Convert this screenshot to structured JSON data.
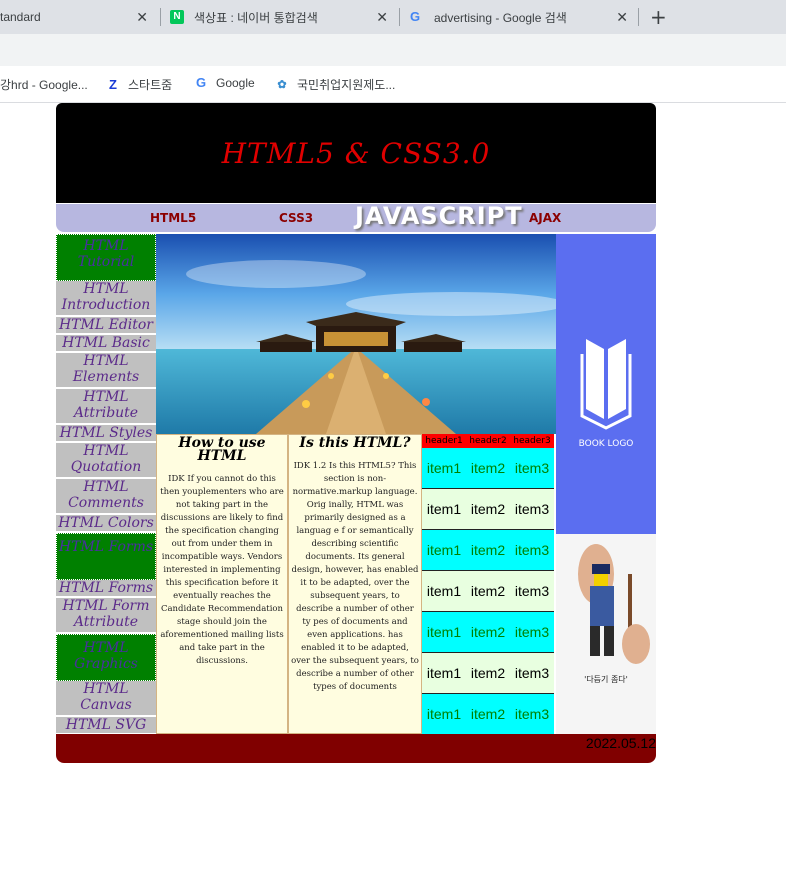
{
  "browser": {
    "tabs": [
      {
        "label": "tandard"
      },
      {
        "label": "색상표 : 네이버 통합검색",
        "favicon": "naver-icon"
      },
      {
        "label": "advertising - Google 검색",
        "favicon": "google-icon"
      }
    ],
    "bookmarks": [
      {
        "label": "강hrd - Google..."
      },
      {
        "label": "스타트줌",
        "icon": "zoom-icon"
      },
      {
        "label": "Google",
        "icon": "google-icon"
      },
      {
        "label": "국민취업지원제도...",
        "icon": "gov-icon"
      }
    ]
  },
  "page": {
    "title": "HTML5 & CSS3.0",
    "nav": [
      "HTML5",
      "CSS3",
      "JAVASCRIPT",
      "AJAX"
    ],
    "sidebar": [
      "HTML Tutorial",
      "HTML Introduction",
      "HTML Editor",
      "HTML Basic",
      "HTML Elements",
      "HTML Attribute",
      "HTML Styles",
      "HTML Quotation",
      "HTML Comments",
      "HTML Colors",
      "HTML Forms",
      "HTML Forms",
      "HTML Form Attribute",
      "HTML Graphics",
      "HTML Canvas",
      "HTML SVG"
    ],
    "article1": {
      "title": "How to use HTML",
      "body": "IDK If you cannot do this then youplementers who are not taking part in the discussions are likely to find the specification changing out from under them in incompatible ways. Vendors interested in implementing this specification before it eventually reaches the Candidate Recommendation stage should join the aforementioned mailing lists and take part in the discussions."
    },
    "article2": {
      "title": "Is this HTML?",
      "body": "IDK 1.2 Is this HTML5? This section is non-normative.markup language. Orig inally, HTML was primarily designed as a languag e f or semantically describing scientific documents. Its general design, however, has enabled it to be adapted, over the subsequent years, to describe a number of other ty pes of documents and even applications. has enabled it to be adapted, over the subsequent years, to describe a number of other types of documents"
    },
    "table": {
      "headers": [
        "header1",
        "header2",
        "header3"
      ],
      "rows": [
        [
          "item1",
          "item2",
          "item3"
        ],
        [
          "item1",
          "item2",
          "item3"
        ],
        [
          "item1",
          "item2",
          "item3"
        ],
        [
          "item1",
          "item2",
          "item3"
        ],
        [
          "item1",
          "item2",
          "item3"
        ],
        [
          "item1",
          "item2",
          "item3"
        ],
        [
          "item1",
          "item2",
          "item3"
        ]
      ]
    },
    "book_logo_text": "BOOK LOGO",
    "book_cover_title": "'다듬기 좀다'",
    "footer_date": "2022.05.12"
  }
}
